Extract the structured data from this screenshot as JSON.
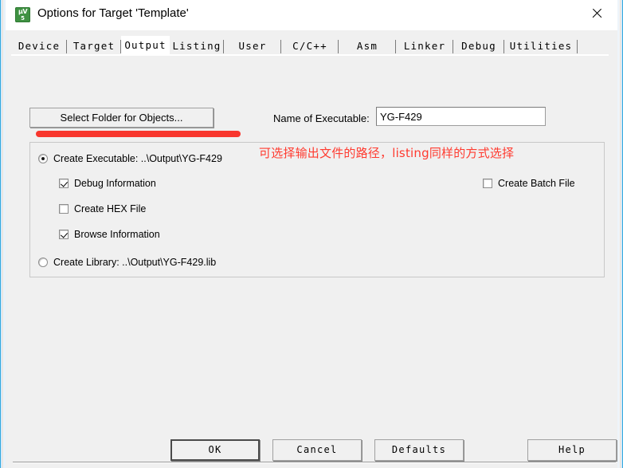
{
  "window": {
    "title": "Options for Target 'Template'",
    "icon": "keil-uvision-icon",
    "icon_line1": "μV",
    "icon_line2": "5",
    "close_icon": "close-icon"
  },
  "tabs": [
    {
      "label": "Device",
      "active": false
    },
    {
      "label": "Target",
      "active": false
    },
    {
      "label": "Output",
      "active": true
    },
    {
      "label": "Listing",
      "active": false
    },
    {
      "label": "User",
      "active": false
    },
    {
      "label": "C/C++",
      "active": false
    },
    {
      "label": "Asm",
      "active": false
    },
    {
      "label": "Linker",
      "active": false
    },
    {
      "label": "Debug",
      "active": false
    },
    {
      "label": "Utilities",
      "active": false
    }
  ],
  "output": {
    "select_folder_button": "Select Folder for Objects...",
    "executable_label": "Name of Executable:",
    "executable_value": "YG-F429",
    "executable_placeholder": "",
    "create_executable": {
      "label": "Create Executable:  ..\\Output\\YG-F429",
      "checked": true
    },
    "debug_information": {
      "label": "Debug Information",
      "checked": true
    },
    "create_hex_file": {
      "label": "Create HEX File",
      "checked": false
    },
    "browse_information": {
      "label": "Browse Information",
      "checked": true
    },
    "create_library": {
      "label": "Create Library:  ..\\Output\\YG-F429.lib",
      "checked": false
    },
    "create_batch_file": {
      "label": "Create Batch File",
      "checked": false
    }
  },
  "annotations": {
    "note_text": "可选择输出文件的路径，listing同样的方式选择",
    "note_color": "#ff3b30",
    "underline_color": "#f8261c"
  },
  "footer": {
    "ok": "OK",
    "cancel": "Cancel",
    "defaults": "Defaults",
    "help": "Help"
  }
}
